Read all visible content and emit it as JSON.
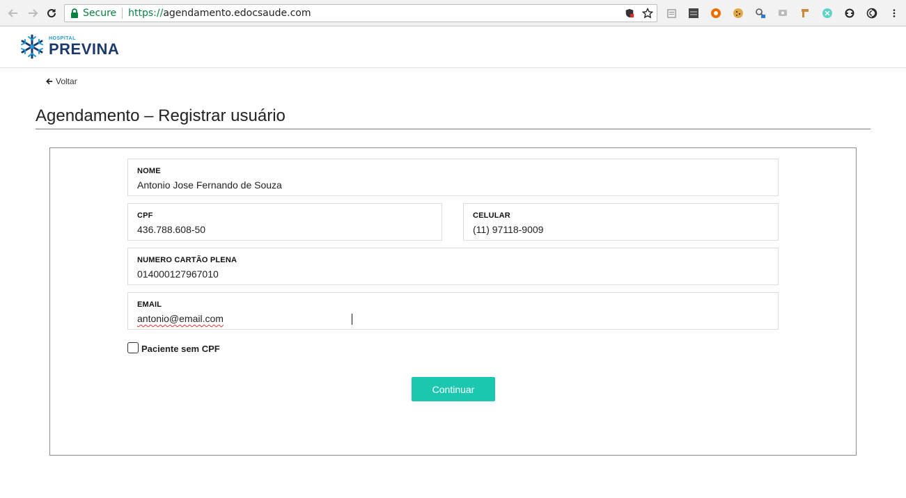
{
  "browser": {
    "secure_label": "Secure",
    "url_scheme": "https://",
    "url_host": "agendamento.edocsaude.com",
    "extensions": [
      "reader-icon",
      "nrt-icon",
      "orange-extension-icon",
      "cookie-icon",
      "search-extension-icon",
      "gray-extension-icon",
      "tag-extension-icon",
      "teal-extension-icon",
      "sync-icon",
      "spiral-icon"
    ]
  },
  "site": {
    "logo_small": "HOSPITAL",
    "logo_big": "PREVINA"
  },
  "page": {
    "back_label": "Voltar",
    "title": "Agendamento – Registrar usuário"
  },
  "form": {
    "nome": {
      "label": "NOME",
      "value": "Antonio Jose Fernando de Souza"
    },
    "cpf": {
      "label": "CPF",
      "value": "436.788.608-50"
    },
    "celular": {
      "label": "CELULAR",
      "value": "(11) 97118-9009"
    },
    "cartao": {
      "label": "NUMERO CARTÃO PLENA",
      "value": "014000127967010"
    },
    "email": {
      "label": "EMAIL",
      "value": "antonio@email.com"
    },
    "checkbox_label": "Paciente sem CPF",
    "checkbox_checked": false,
    "submit_label": "Continuar"
  },
  "colors": {
    "accent": "#1cc7b0",
    "brand_dark": "#1b3a6b",
    "brand_light": "#1f9ad6",
    "secure_green": "#0b8043"
  }
}
